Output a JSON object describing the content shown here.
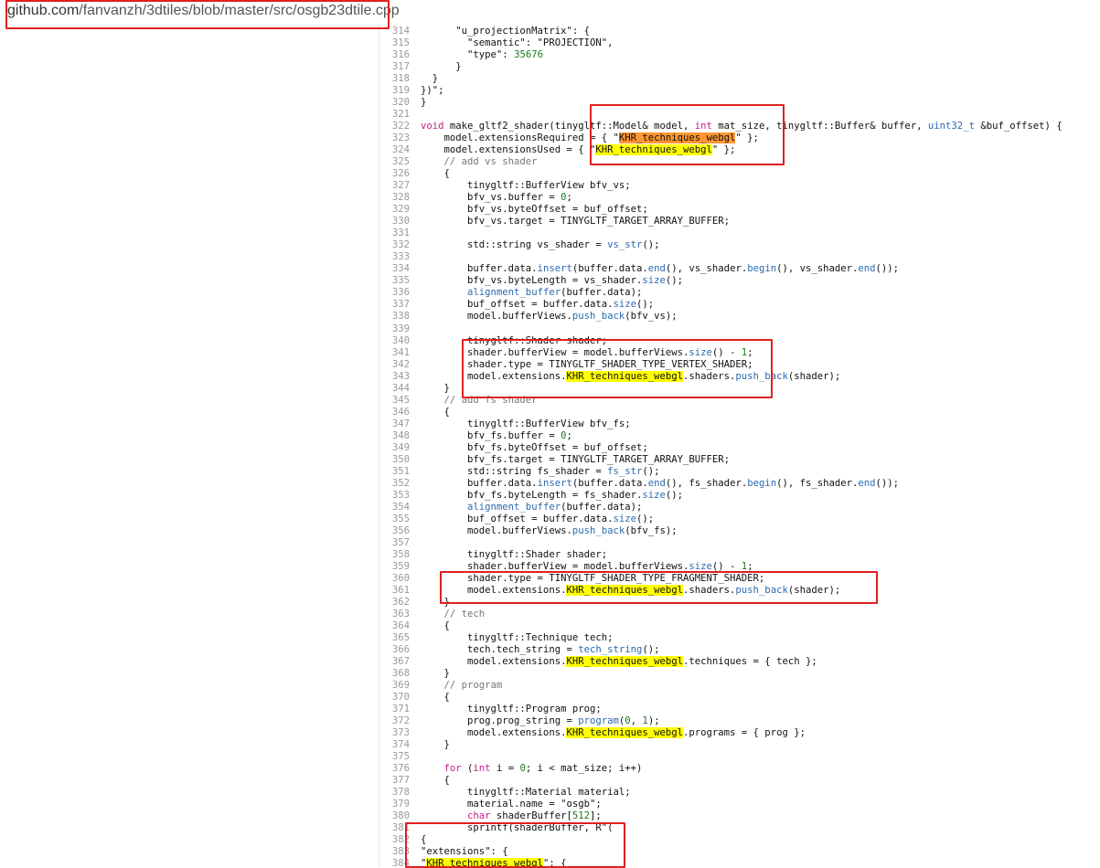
{
  "address_bar": {
    "url_host": "github.com",
    "url_path": "/fanvanzh/3dtiles/blob/master/src/osgb23dtile.cpp"
  },
  "code": {
    "lines": [
      {
        "n": "314",
        "t": "      \"u_projectionMatrix\": {"
      },
      {
        "n": "315",
        "t": "        \"semantic\": \"PROJECTION\","
      },
      {
        "n": "316",
        "t": "        \"type\": 35676"
      },
      {
        "n": "317",
        "t": "      }"
      },
      {
        "n": "318",
        "t": "  }"
      },
      {
        "n": "319",
        "t": "})\";"
      },
      {
        "n": "320",
        "t": "}"
      },
      {
        "n": "321",
        "t": ""
      },
      {
        "n": "322",
        "t": "void make_gltf2_shader(tinygltf::Model& model, int mat_size, tinygltf::Buffer& buffer, uint32_t &buf_offset) {"
      },
      {
        "n": "323",
        "t": "    model.extensionsRequired = { \"KHR_techniques_webgl\" };"
      },
      {
        "n": "324",
        "t": "    model.extensionsUsed = { \"KHR_techniques_webgl\" };"
      },
      {
        "n": "325",
        "t": "    // add vs shader"
      },
      {
        "n": "326",
        "t": "    {"
      },
      {
        "n": "327",
        "t": "        tinygltf::BufferView bfv_vs;"
      },
      {
        "n": "328",
        "t": "        bfv_vs.buffer = 0;"
      },
      {
        "n": "329",
        "t": "        bfv_vs.byteOffset = buf_offset;"
      },
      {
        "n": "330",
        "t": "        bfv_vs.target = TINYGLTF_TARGET_ARRAY_BUFFER;"
      },
      {
        "n": "331",
        "t": ""
      },
      {
        "n": "332",
        "t": "        std::string vs_shader = vs_str();"
      },
      {
        "n": "333",
        "t": ""
      },
      {
        "n": "334",
        "t": "        buffer.data.insert(buffer.data.end(), vs_shader.begin(), vs_shader.end());"
      },
      {
        "n": "335",
        "t": "        bfv_vs.byteLength = vs_shader.size();"
      },
      {
        "n": "336",
        "t": "        alignment_buffer(buffer.data);"
      },
      {
        "n": "337",
        "t": "        buf_offset = buffer.data.size();"
      },
      {
        "n": "338",
        "t": "        model.bufferViews.push_back(bfv_vs);"
      },
      {
        "n": "339",
        "t": ""
      },
      {
        "n": "340",
        "t": "        tinygltf::Shader shader;"
      },
      {
        "n": "341",
        "t": "        shader.bufferView = model.bufferViews.size() - 1;"
      },
      {
        "n": "342",
        "t": "        shader.type = TINYGLTF_SHADER_TYPE_VERTEX_SHADER;"
      },
      {
        "n": "343",
        "t": "        model.extensions.KHR_techniques_webgl.shaders.push_back(shader);"
      },
      {
        "n": "344",
        "t": "    }"
      },
      {
        "n": "345",
        "t": "    // add fs shader"
      },
      {
        "n": "346",
        "t": "    {"
      },
      {
        "n": "347",
        "t": "        tinygltf::BufferView bfv_fs;"
      },
      {
        "n": "348",
        "t": "        bfv_fs.buffer = 0;"
      },
      {
        "n": "349",
        "t": "        bfv_fs.byteOffset = buf_offset;"
      },
      {
        "n": "350",
        "t": "        bfv_fs.target = TINYGLTF_TARGET_ARRAY_BUFFER;"
      },
      {
        "n": "351",
        "t": "        std::string fs_shader = fs_str();"
      },
      {
        "n": "352",
        "t": "        buffer.data.insert(buffer.data.end(), fs_shader.begin(), fs_shader.end());"
      },
      {
        "n": "353",
        "t": "        bfv_fs.byteLength = fs_shader.size();"
      },
      {
        "n": "354",
        "t": "        alignment_buffer(buffer.data);"
      },
      {
        "n": "355",
        "t": "        buf_offset = buffer.data.size();"
      },
      {
        "n": "356",
        "t": "        model.bufferViews.push_back(bfv_fs);"
      },
      {
        "n": "357",
        "t": ""
      },
      {
        "n": "358",
        "t": "        tinygltf::Shader shader;"
      },
      {
        "n": "359",
        "t": "        shader.bufferView = model.bufferViews.size() - 1;"
      },
      {
        "n": "360",
        "t": "        shader.type = TINYGLTF_SHADER_TYPE_FRAGMENT_SHADER;"
      },
      {
        "n": "361",
        "t": "        model.extensions.KHR_techniques_webgl.shaders.push_back(shader);"
      },
      {
        "n": "362",
        "t": "    }"
      },
      {
        "n": "363",
        "t": "    // tech"
      },
      {
        "n": "364",
        "t": "    {"
      },
      {
        "n": "365",
        "t": "        tinygltf::Technique tech;"
      },
      {
        "n": "366",
        "t": "        tech.tech_string = tech_string();"
      },
      {
        "n": "367",
        "t": "        model.extensions.KHR_techniques_webgl.techniques = { tech };"
      },
      {
        "n": "368",
        "t": "    }"
      },
      {
        "n": "369",
        "t": "    // program"
      },
      {
        "n": "370",
        "t": "    {"
      },
      {
        "n": "371",
        "t": "        tinygltf::Program prog;"
      },
      {
        "n": "372",
        "t": "        prog.prog_string = program(0, 1);"
      },
      {
        "n": "373",
        "t": "        model.extensions.KHR_techniques_webgl.programs = { prog };"
      },
      {
        "n": "374",
        "t": "    }"
      },
      {
        "n": "375",
        "t": ""
      },
      {
        "n": "376",
        "t": "    for (int i = 0; i < mat_size; i++)"
      },
      {
        "n": "377",
        "t": "    {"
      },
      {
        "n": "378",
        "t": "        tinygltf::Material material;"
      },
      {
        "n": "379",
        "t": "        material.name = \"osgb\";"
      },
      {
        "n": "380",
        "t": "        char shaderBuffer[512];"
      },
      {
        "n": "381",
        "t": "        sprintf(shaderBuffer, R\"("
      },
      {
        "n": "382",
        "t": "{"
      },
      {
        "n": "383",
        "t": "\"extensions\": {"
      },
      {
        "n": "384",
        "t": "\"KHR_techniques_webgl\": {"
      }
    ]
  },
  "highlight_term": "KHR_techniques_webgl",
  "colors": {
    "highlight": "#ffff00",
    "highlight_current": "#ff9632",
    "annotation_box": "#e02020"
  }
}
